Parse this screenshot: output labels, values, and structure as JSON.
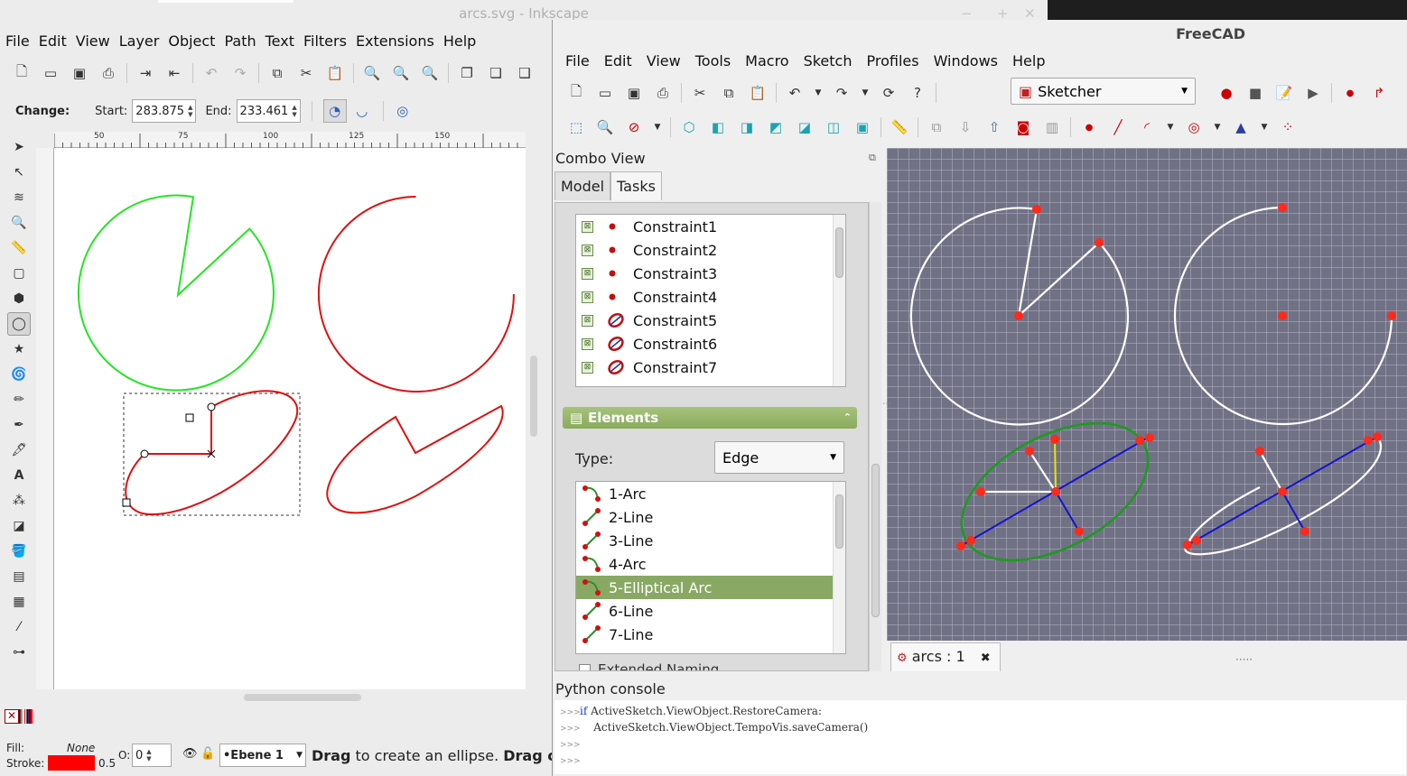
{
  "inkscape": {
    "title": "arcs.svg - Inkscape",
    "menu": [
      "File",
      "Edit",
      "View",
      "Layer",
      "Object",
      "Path",
      "Text",
      "Filters",
      "Extensions",
      "Help"
    ],
    "ctrl": {
      "change_label": "Change:",
      "start_label": "Start:",
      "start_value": "283.875",
      "end_label": "End:",
      "end_value": "233.461"
    },
    "ruler_ticks": [
      "50",
      "75",
      "100",
      "125",
      "150"
    ],
    "status": {
      "fill_label": "Fill:",
      "fill_value": "None",
      "stroke_label": "Stroke:",
      "stroke_width": "0.5",
      "opacity_label": "O:",
      "opacity_value": "0",
      "layer": "•Ebene 1",
      "message_bold": "Drag",
      "message": " to create an ellipse. ",
      "message_bold2": "Drag con"
    },
    "colors": {
      "green_shape": "#22e622",
      "red_shape": "#e01010",
      "stroke_swatch": "#ff0000"
    },
    "palette": [
      "#000000",
      "#1a1a1a",
      "#333333",
      "#4d4d4d",
      "#666666",
      "#808080",
      "#999999",
      "#b3b3b3",
      "#cccccc",
      "#e6e6e6",
      "#f2f2f2",
      "#ffffff",
      "#800000",
      "#ff0000",
      "#808000",
      "#ffff00",
      "#008000",
      "#00ff00",
      "#008080",
      "#00ffff",
      "#000080",
      "#0000ff",
      "#800080",
      "#ff00ff",
      "#550000",
      "#660000",
      "#800000",
      "#aa0000",
      "#d40000",
      "#ff0000",
      "#ff2a2a",
      "#ff5555",
      "#ff8080",
      "#ffaaaa"
    ]
  },
  "freecad": {
    "title": "FreeCAD",
    "menu": [
      "File",
      "Edit",
      "View",
      "Tools",
      "Macro",
      "Sketch",
      "Profiles",
      "Windows",
      "Help"
    ],
    "workbench": "Sketcher",
    "combo_view": "Combo View",
    "tabs": [
      "Model",
      "Tasks"
    ],
    "constraints": [
      "Constraint1",
      "Constraint2",
      "Constraint3",
      "Constraint4",
      "Constraint5",
      "Constraint6",
      "Constraint7"
    ],
    "elements_header": "Elements",
    "type_label": "Type:",
    "type_value": "Edge",
    "elements": [
      "1-Arc",
      "2-Line",
      "3-Line",
      "4-Arc",
      "5-Elliptical Arc",
      "6-Line",
      "7-Line"
    ],
    "selected_element": "5-Elliptical Arc",
    "extended_naming": "Extended Naming",
    "doc_tab": "arcs : 1",
    "python_console": "Python console",
    "console_lines": [
      {
        "kw": "if",
        "text": " ActiveSketch.ViewObject.RestoreCamera:"
      },
      {
        "kw": "",
        "text": "    ActiveSketch.ViewObject.TempoVis.saveCamera()"
      },
      {
        "kw": "",
        "text": ""
      },
      {
        "kw": "",
        "text": ""
      }
    ]
  }
}
